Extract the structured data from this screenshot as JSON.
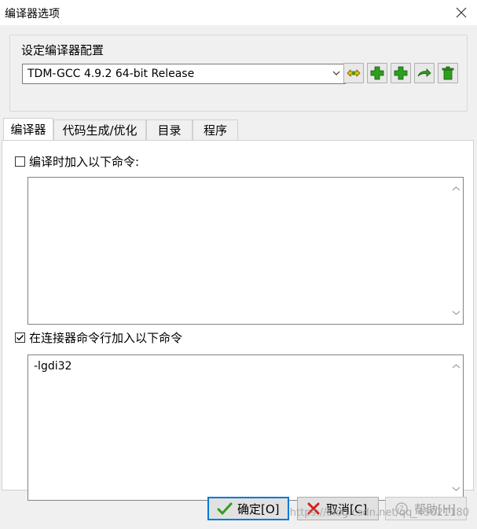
{
  "window": {
    "title": "编译器选项"
  },
  "config_group": {
    "title": "设定编译器配置",
    "selected_compiler": "TDM-GCC 4.9.2 64-bit Release"
  },
  "tabs": [
    {
      "label": "编译器"
    },
    {
      "label": "代码生成/优化"
    },
    {
      "label": "目录"
    },
    {
      "label": "程序"
    }
  ],
  "compiler_tab": {
    "compile_cmd_label": "编译时加入以下命令:",
    "compile_cmd_checked": false,
    "compile_cmd_value": "",
    "linker_cmd_label": "在连接器命令行加入以下命令",
    "linker_cmd_checked": true,
    "linker_cmd_value": "-lgdi32"
  },
  "buttons": {
    "ok": "确定[O]",
    "cancel": "取消[C]",
    "help": "帮助[H]"
  },
  "watermark": "https://blog.csdn.net/qq_45021180",
  "colors": {
    "accent": "#0078d7",
    "icon_green": "#2e9e1e",
    "icon_yellow": "#e8c000",
    "cancel_red": "#d42020"
  }
}
